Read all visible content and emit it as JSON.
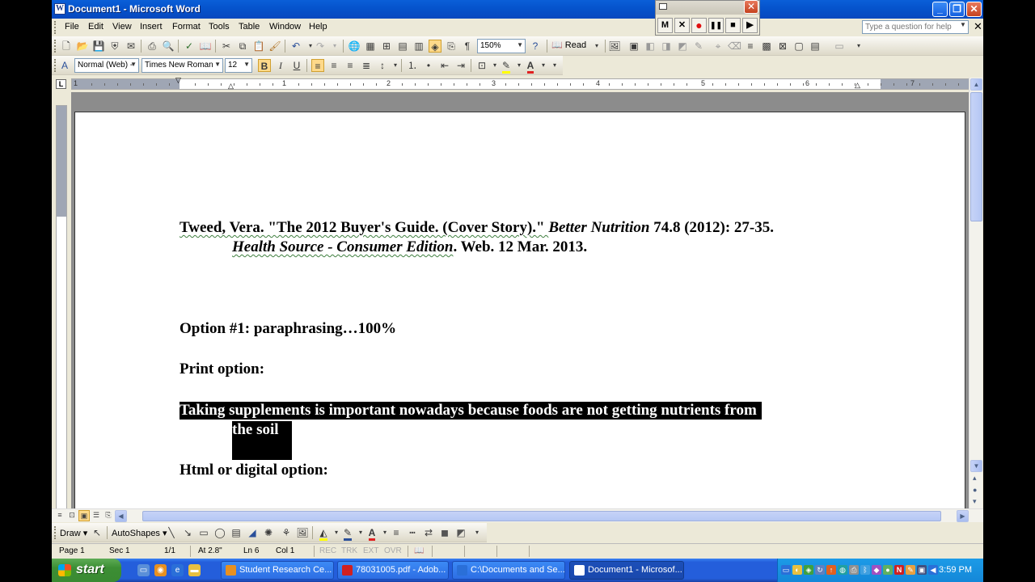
{
  "window": {
    "title": "Document1 - Microsoft Word",
    "minimize": "_",
    "restore": "❐",
    "close": "✕"
  },
  "recorder": {
    "buttons": [
      "M",
      "✕",
      "●",
      "❚❚",
      "■",
      "▶"
    ],
    "close": "✕"
  },
  "menubar": {
    "items": [
      "File",
      "Edit",
      "View",
      "Insert",
      "Format",
      "Tools",
      "Table",
      "Window",
      "Help"
    ],
    "help_placeholder": "Type a question for help",
    "doc_close": "✕"
  },
  "standard_toolbar": {
    "zoom": "150%",
    "read_label": "Read"
  },
  "formatting_toolbar": {
    "style": "Normal (Web) -",
    "font": "Times New Roman",
    "size": "12",
    "bold": "B",
    "italic": "I",
    "underline": "U",
    "font_color_letter": "A",
    "font_color": "#e02020",
    "highlight_color": "#ffff00"
  },
  "ruler": {
    "corner": "L",
    "numbers": [
      "1",
      "1",
      "2",
      "3",
      "4",
      "5",
      "6",
      "7"
    ]
  },
  "document": {
    "citation_line1_a": "Tweed, Vera. \"The 2012 Buyer's Guide. (Cover Story).\" ",
    "citation_line1_b": "Better Nutrition",
    "citation_line1_c": " 74.8 (2012): 27-35.",
    "citation_line2_a": "Health Source - Consumer Edition",
    "citation_line2_b": ". Web. 12 Mar. 2013.",
    "option1": "Option #1: paraphrasing…100%",
    "print_option": "Print option:",
    "selected_line1": "Taking supplements is important nowadays because foods are not getting nutrients from ",
    "selected_line2": "the soil",
    "html_option": "Html or digital option:"
  },
  "draw_toolbar": {
    "draw_label": "Draw ▾",
    "autoshapes_label": "AutoShapes ▾"
  },
  "statusbar": {
    "page": "Page 1",
    "sec": "Sec 1",
    "pages": "1/1",
    "at": "At 2.8\"",
    "ln": "Ln 6",
    "col": "Col 1",
    "rec": "REC",
    "trk": "TRK",
    "ext": "EXT",
    "ovr": "OVR"
  },
  "taskbar": {
    "start": "start",
    "tasks": [
      "Student Research Ce...",
      "78031005.pdf - Adob...",
      "C:\\Documents and Se...",
      "Document1 - Microsof..."
    ],
    "clock": "3:59 PM"
  }
}
